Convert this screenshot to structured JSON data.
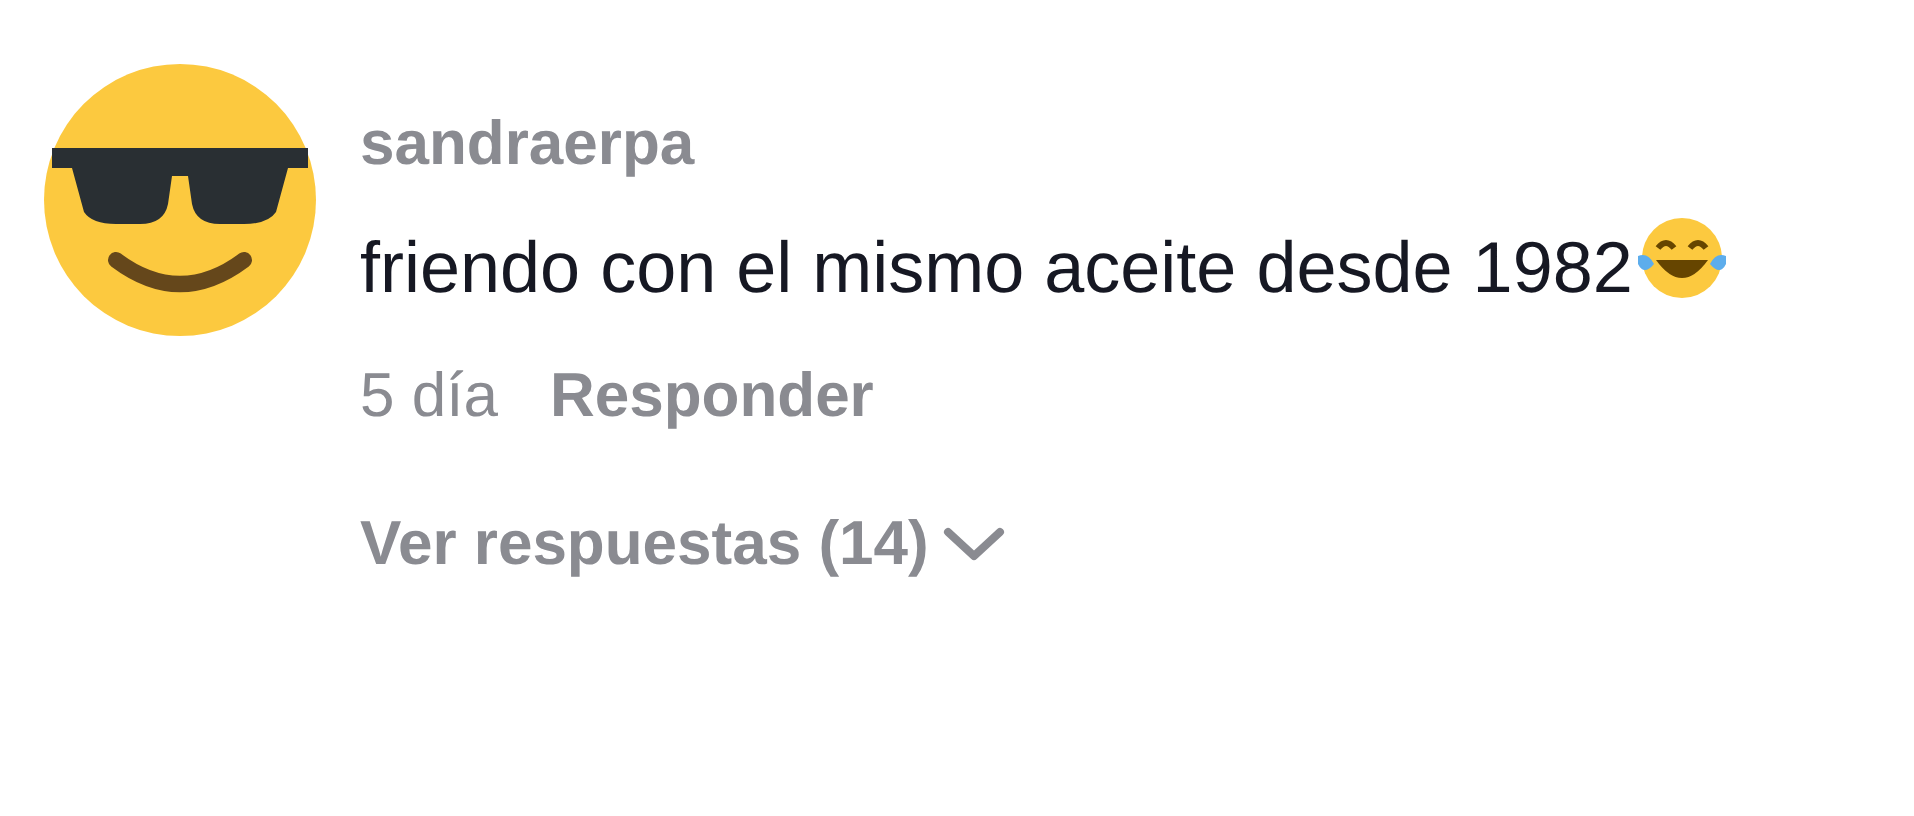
{
  "comment": {
    "username": "sandraerpa",
    "text": "friendo con el mismo aceite desde 1982",
    "time": "5 día",
    "reply": "Responder",
    "replies_toggle": "Ver respuestas (14)"
  }
}
